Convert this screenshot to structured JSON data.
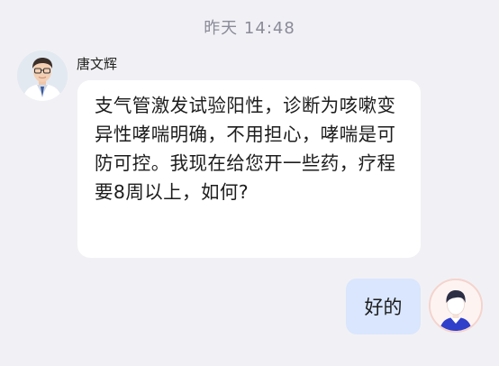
{
  "chat": {
    "timestamp": "昨天  14:48",
    "messages": [
      {
        "sender": "唐文辉",
        "avatar_icon": "doctor-avatar-photo",
        "text": "支气管激发试验阳性，诊断为咳嗽变异性哮喘明确，不用担心，哮喘是可防可控。我现在给您开一些药，疗程要8周以上，如何?"
      },
      {
        "sender": "self",
        "avatar_icon": "user-avatar-icon",
        "text": "好的"
      }
    ]
  },
  "colors": {
    "background": "#f1f1f5",
    "incoming_bubble": "#ffffff",
    "outgoing_bubble": "#d9e6fd",
    "timestamp_text": "#8b8b99"
  }
}
